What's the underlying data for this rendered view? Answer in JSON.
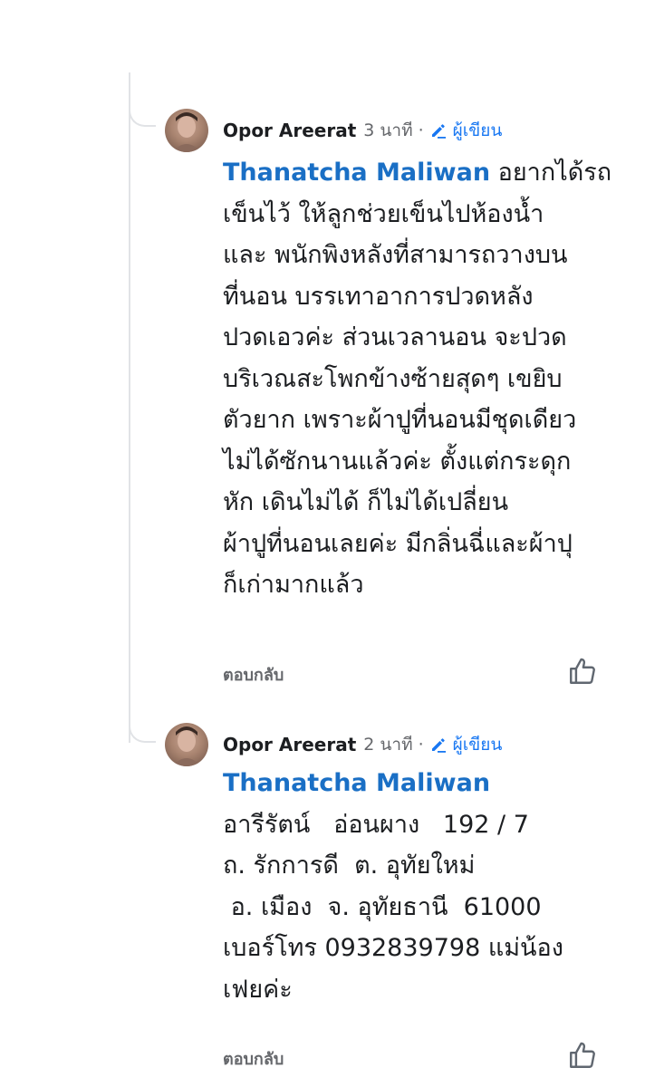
{
  "comments": [
    {
      "author": "Opor Areerat",
      "time": "3 นาที",
      "separator": "·",
      "role": "ผู้เขียน",
      "mention": "Thanatcha Maliwan",
      "lines": [
        "อยากได้รถ",
        "เข็นไว้ ให้ลูกช่วยเข็นไปห้องน้ำ",
        "และ  พนักพิงหลังที่สามารถวางบน",
        "ที่นอน  บรรเทาอาการปวดหลัง",
        "ปวดเอวค่ะ  ส่วนเวลานอน จะปวด",
        "บริเวณสะโพกข้างซ้ายสุดๆ เขยิบ",
        "ตัวยาก เพราะผ้าปูที่นอนมีชุดเดียว",
        "ไม่ได้ซักนานแล้วค่ะ ตั้งแต่กระดุก",
        "หัก เดินไม่ได้ ก็ไม่ได้เปลี่ยน",
        "ผ้าปูที่นอนเลยค่ะ มีกลิ่นฉี่และผ้าปุ",
        "ก็เก่ามากแล้ว"
      ],
      "reply": "ตอบกลับ",
      "like_icon": "thumbs-up-icon",
      "dislike_icon": "thumbs-down-icon"
    },
    {
      "author": "Opor Areerat",
      "time": "2 นาที",
      "separator": "·",
      "role": "ผู้เขียน",
      "mention": "Thanatcha Maliwan",
      "lines": [
        "อารีรัตน์   อ่อนผาง   192 / 7",
        "ถ. รักการดี  ต. อุทัยใหม่",
        " อ. เมือง  จ. อุทัยธานี  61000",
        "เบอร์โทร 0932839798 แม่น้อง",
        "เฟยค่ะ"
      ],
      "reply": "ตอบกลับ",
      "like_icon": "thumbs-up-icon",
      "dislike_icon": "thumbs-down-icon"
    }
  ],
  "colors": {
    "mention": "#1a6fc5",
    "role": "#1877f2",
    "meta": "#65676b",
    "thread_line": "#e1e3e6"
  }
}
